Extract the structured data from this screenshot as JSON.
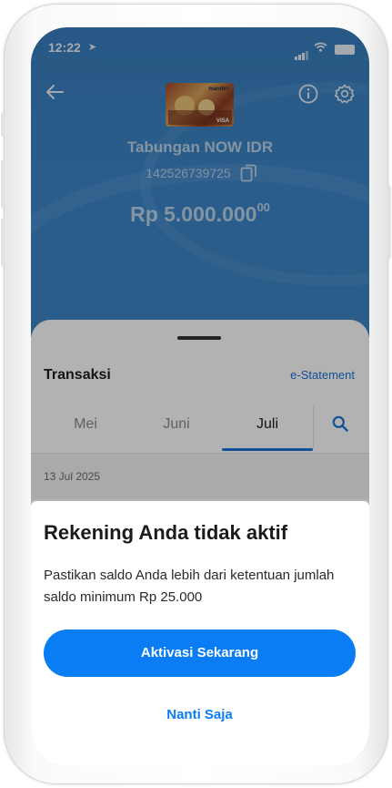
{
  "status_bar": {
    "time": "12:22",
    "location_icon": "location-arrow-icon",
    "signal_icon": "cellular-signal-icon",
    "wifi_icon": "wifi-icon",
    "battery_icon": "battery-icon"
  },
  "header": {
    "back_icon": "back-arrow-icon",
    "info_icon": "info-icon",
    "settings_icon": "gear-icon",
    "card": {
      "brand": "mandiri",
      "network": "VISA"
    }
  },
  "account": {
    "name": "Tabungan NOW IDR",
    "number": "142526739725",
    "copy_icon": "copy-icon",
    "balance_main": "Rp 5.000.000",
    "balance_cents": "00"
  },
  "transactions": {
    "title": "Transaksi",
    "estatement_label": "e-Statement",
    "tabs": [
      {
        "label": "Mei",
        "active": false
      },
      {
        "label": "Juni",
        "active": false
      },
      {
        "label": "Juli",
        "active": true
      }
    ],
    "search_icon": "search-icon",
    "date_header": "13 Jul 2025"
  },
  "modal": {
    "title": "Rekening Anda tidak aktif",
    "message": "Pastikan saldo Anda lebih dari ketentuan jumlah saldo minimum Rp 25.000",
    "primary_label": "Aktivasi Sekarang",
    "secondary_label": "Nanti Saja"
  },
  "colors": {
    "hero_blue": "#3d86c7",
    "accent_blue": "#0a7cf4",
    "link_blue": "#1a73d9"
  }
}
